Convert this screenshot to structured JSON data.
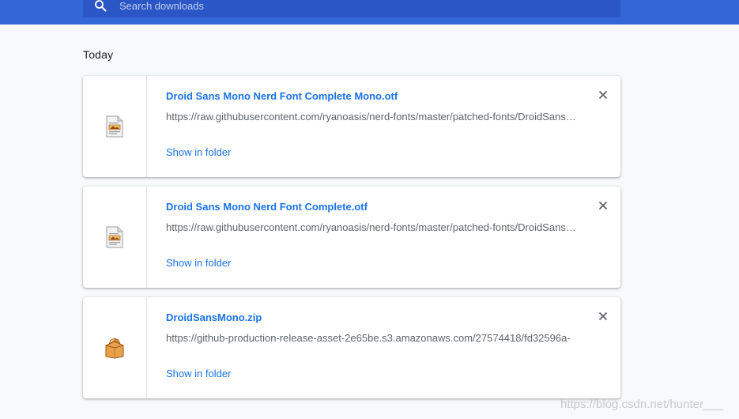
{
  "search": {
    "placeholder": "Search downloads"
  },
  "section": {
    "title": "Today"
  },
  "downloads": [
    {
      "name": "Droid Sans Mono Nerd Font Complete Mono.otf",
      "url": "https://raw.githubusercontent.com/ryanoasis/nerd-fonts/master/patched-fonts/DroidSansMono/complete/Droid Sans Mono Nerd Font Complete Mono.otf",
      "action": "Show in folder",
      "icon": "font-file-icon"
    },
    {
      "name": "Droid Sans Mono Nerd Font Complete.otf",
      "url": "https://raw.githubusercontent.com/ryanoasis/nerd-fonts/master/patched-fonts/DroidSansMono/complete/Droid Sans Mono Nerd Font Complete.otf",
      "action": "Show in folder",
      "icon": "font-file-icon"
    },
    {
      "name": "DroidSansMono.zip",
      "url": "https://github-production-release-asset-2e65be.s3.amazonaws.com/27574418/fd32596a-",
      "action": "Show in folder",
      "icon": "archive-file-icon"
    }
  ],
  "watermark": "https://blog.csdn.net/hunter___",
  "colors": {
    "header": "#3367d6",
    "search_box": "#2a56c6",
    "link": "#1a73e8",
    "background": "#f8f9fa"
  }
}
